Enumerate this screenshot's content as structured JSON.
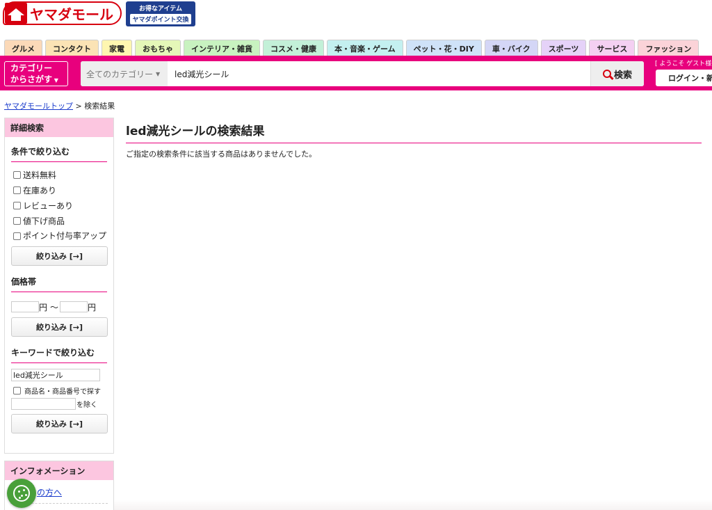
{
  "header": {
    "logo_text": "ヤマダモール",
    "point_badge_top": "お得なアイテム",
    "point_badge_bottom": "ヤマダポイント交換"
  },
  "tabs": [
    {
      "label": "グルメ",
      "color": "#fbd9b8"
    },
    {
      "label": "コンタクト",
      "color": "#fbe3b5"
    },
    {
      "label": "家電",
      "color": "#fef6b0"
    },
    {
      "label": "おもちゃ",
      "color": "#e5f7b8"
    },
    {
      "label": "インテリア・雑貨",
      "color": "#c8f2c0"
    },
    {
      "label": "コスメ・健康",
      "color": "#c3f0d8"
    },
    {
      "label": "本・音楽・ゲーム",
      "color": "#c4f0f0"
    },
    {
      "label": "ペット・花・DIY",
      "color": "#cfe2f8"
    },
    {
      "label": "車・バイク",
      "color": "#d4d6f6"
    },
    {
      "label": "スポーツ",
      "color": "#e5d2f8"
    },
    {
      "label": "サービス",
      "color": "#f4d0f2"
    },
    {
      "label": "ファッション",
      "color": "#fbd3d8"
    }
  ],
  "search": {
    "category_button": "カテゴリー\nからさがす",
    "category_select": "全てのカテゴリー",
    "query": "led減光シール",
    "button_label": "検索",
    "welcome": "[ ようこそ ゲスト様",
    "login_label": "ログイン・新"
  },
  "breadcrumb": {
    "home": "ヤマダモールトップ",
    "separator": ">",
    "current": "検索結果"
  },
  "sidebar": {
    "heading": "詳細検索",
    "conditions_heading": "条件で絞り込む",
    "conditions": [
      "送料無料",
      "在庫あり",
      "レビューあり",
      "値下げ商品",
      "ポイント付与率アップ"
    ],
    "filter_button": "絞り込み [→]",
    "price_heading": "価格帯",
    "price_unit": "円",
    "price_separator": "〜",
    "keyword_heading": "キーワードで絞り込む",
    "keyword_value": "led減光シール",
    "keyword_check_label": "商品名・商品番号で探す",
    "exclude_label": "を除く"
  },
  "info": {
    "heading": "インフォメーション",
    "link": "の方へ"
  },
  "main": {
    "title": "led減光シールの検索結果",
    "no_result": "ご指定の検索条件に該当する商品はありませんでした。"
  }
}
